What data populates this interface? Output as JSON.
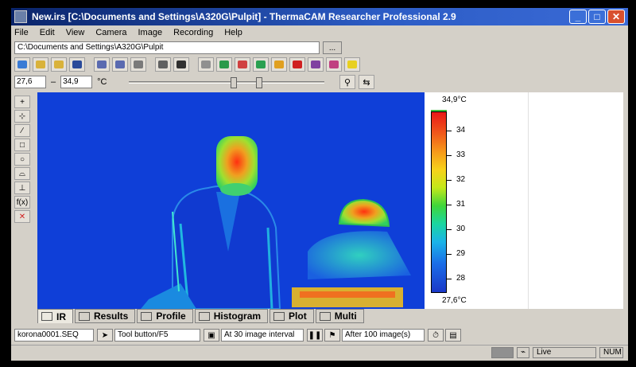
{
  "window": {
    "title": "New.irs [C:\\Documents and Settings\\A320G\\Pulpit] - ThermaCAM Researcher Professional 2.9",
    "minimize": "_",
    "maximize": "□",
    "close": "✕"
  },
  "menu": [
    "File",
    "Edit",
    "View",
    "Camera",
    "Image",
    "Recording",
    "Help"
  ],
  "path": {
    "value": "C:\\Documents and Settings\\A320G\\Pulpit",
    "browse_label": "..."
  },
  "toolbar_icons": [
    {
      "name": "new-icon",
      "color": "#3a7bd5"
    },
    {
      "name": "open-icon",
      "color": "#d9b23a"
    },
    {
      "name": "open-sequence-icon",
      "color": "#d9b23a"
    },
    {
      "name": "save-icon",
      "color": "#2a4a9a"
    },
    {
      "name": "copy-icon",
      "color": "#5a6ab0"
    },
    {
      "name": "copy-sequence-icon",
      "color": "#5a6ab0"
    },
    {
      "name": "report-icon",
      "color": "#7a7a7a"
    },
    {
      "name": "print-icon",
      "color": "#606060"
    },
    {
      "name": "arrows-icon",
      "color": "#303030"
    },
    {
      "name": "camera-icon",
      "color": "#909090"
    },
    {
      "name": "palette-icon",
      "color": "#2a9a4a"
    },
    {
      "name": "target-icon",
      "color": "#d04040"
    },
    {
      "name": "star-icon",
      "color": "#2aa050"
    },
    {
      "name": "bulb-icon",
      "color": "#e0a020"
    },
    {
      "name": "stop-icon",
      "color": "#d02020"
    },
    {
      "name": "record-icon",
      "color": "#8040a0"
    },
    {
      "name": "settings-icon",
      "color": "#c04080"
    },
    {
      "name": "help-icon",
      "color": "#e8d020"
    }
  ],
  "range": {
    "min": "27,6",
    "separator": "–",
    "max": "34,9",
    "unit": "°C"
  },
  "left_tools": [
    "+",
    "⊹",
    "∕",
    "□",
    "○",
    "⌓",
    "⊥",
    "f(x)",
    "✕"
  ],
  "scale": {
    "max_label": "34,9°C",
    "min_label": "27,6°C",
    "ticks": [
      "34",
      "33",
      "32",
      "31",
      "30",
      "29",
      "28"
    ]
  },
  "tabs": [
    {
      "label": "IR",
      "icon": "ir-icon",
      "active": true
    },
    {
      "label": "Results",
      "icon": "table-icon",
      "active": false
    },
    {
      "label": "Profile",
      "icon": "profile-icon",
      "active": false
    },
    {
      "label": "Histogram",
      "icon": "histogram-icon",
      "active": false
    },
    {
      "label": "Plot",
      "icon": "plot-icon",
      "active": false
    },
    {
      "label": "Multi",
      "icon": "multi-icon",
      "active": false
    }
  ],
  "recording": {
    "file": "korona0001.SEQ",
    "trigger": "Tool button/F5",
    "interval": "At 30 image interval",
    "stop": "After 100 image(s)"
  },
  "status": {
    "mode": "Live",
    "num": "NUM"
  }
}
